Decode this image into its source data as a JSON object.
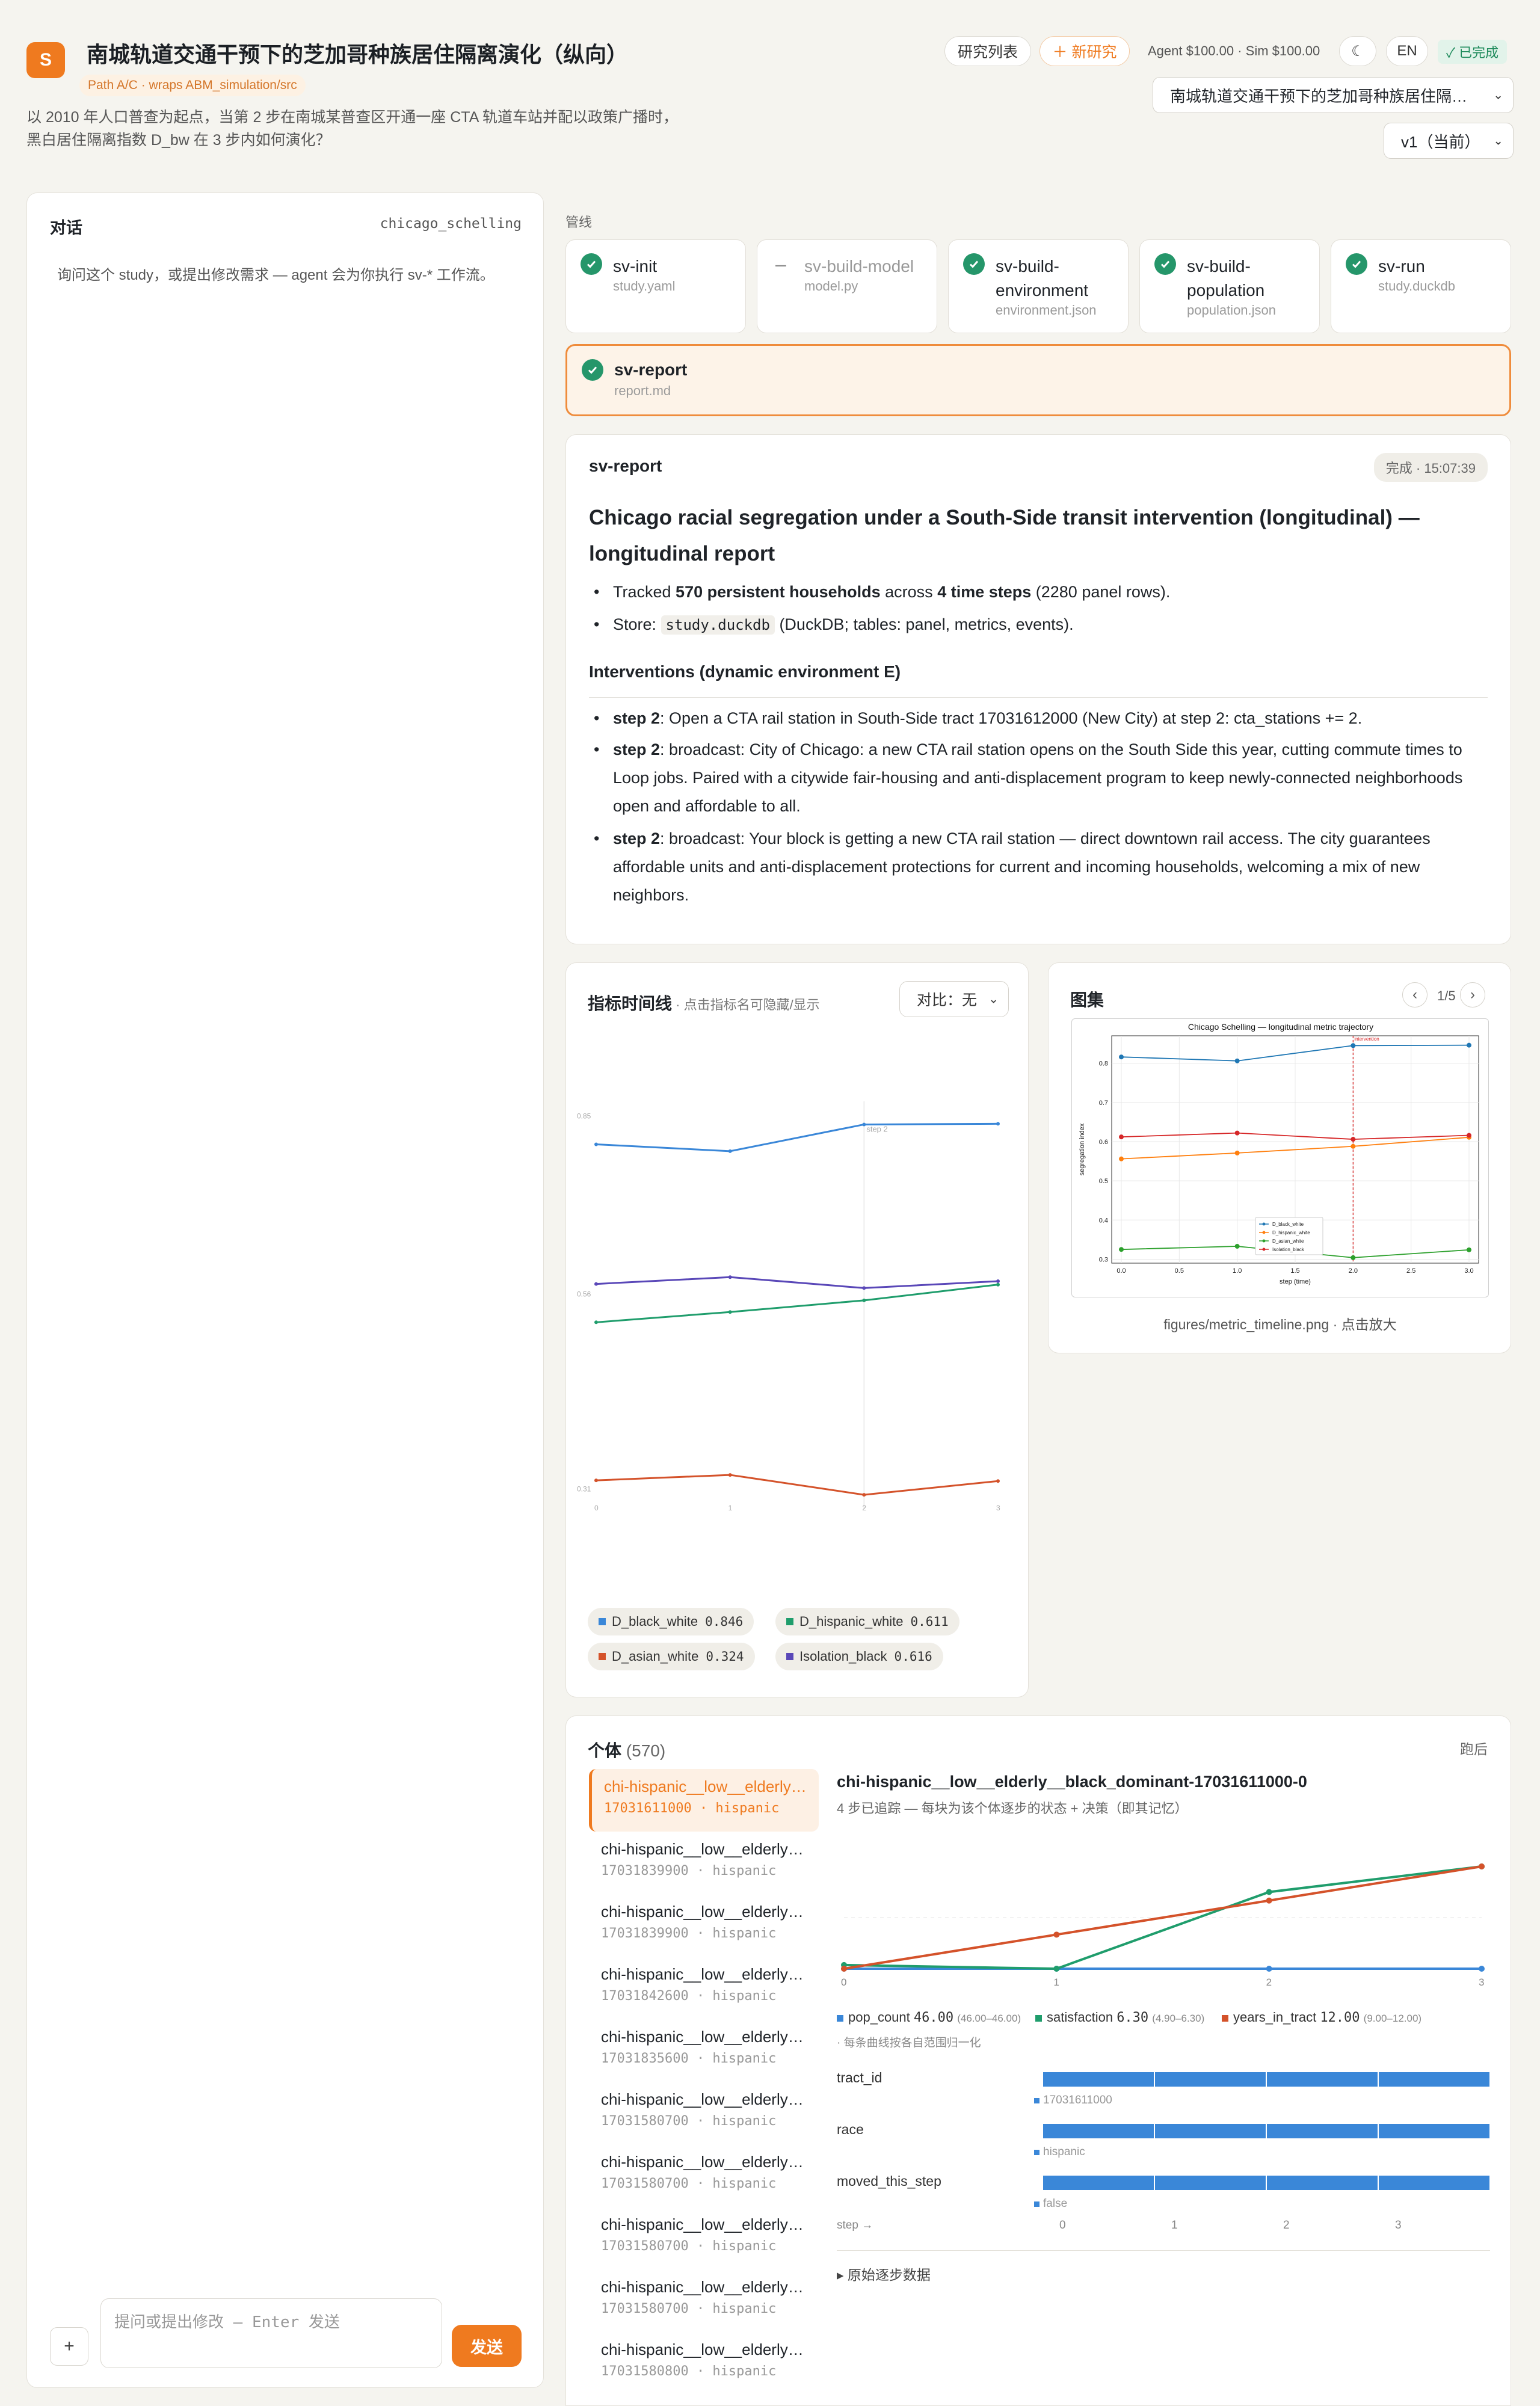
{
  "header": {
    "logo_letter": "S",
    "title": "南城轨道交通干预下的芝加哥种族居住隔离演化（纵向）",
    "path_badge": "Path A/C · wraps ABM_simulation/src",
    "description": "以 2010 年人口普查为起点，当第 2 步在南城某普查区开通一座 CTA 轨道车站并配以政策广播时，黑白居住隔离指数 D_bw 在 3 步内如何演化？",
    "btn_list": "研究列表",
    "btn_new": "＋ 新研究",
    "budget": "Agent $100.00 · Sim $100.00",
    "theme_icon": "☾",
    "lang": "EN",
    "status": "✓ 已完成",
    "study_select": "南城轨道交通干预下的芝加哥种族居住隔…",
    "version_select": "v1（当前）"
  },
  "chat": {
    "title": "对话",
    "study_id": "chicago_schelling",
    "hint": "询问这个 study，或提出修改需求 — agent 会为你执行 sv-* 工作流。",
    "input_placeholder": "提问或提出修改 — Enter 发送",
    "plus": "+",
    "send": "发送"
  },
  "pipeline": {
    "label": "管线",
    "stages": [
      {
        "name": "sv-init",
        "file": "study.yaml",
        "status": "done"
      },
      {
        "name": "sv-build-model",
        "file": "model.py",
        "status": "skipped"
      },
      {
        "name": "sv-build-environment",
        "file": "environment.json",
        "status": "done"
      },
      {
        "name": "sv-build-population",
        "file": "population.json",
        "status": "done"
      },
      {
        "name": "sv-run",
        "file": "study.duckdb",
        "status": "done"
      },
      {
        "name": "sv-report",
        "file": "report.md",
        "status": "done"
      }
    ]
  },
  "report": {
    "stage": "sv-report",
    "badge": "完成 · 15:07:39",
    "title": "Chicago racial segregation under a South-Side transit intervention (longitudinal) — longitudinal report",
    "b1_pre": "Tracked ",
    "b1_bold": "570 persistent households",
    "b1_mid": " across ",
    "b1_bold2": "4 time steps",
    "b1_post": " (2280 panel rows).",
    "b2_pre": "Store: ",
    "b2_code": "study.duckdb",
    "b2_post": " (DuckDB; tables: panel, metrics, events).",
    "interventions_title": "Interventions (dynamic environment E)",
    "i1_step": "step 2",
    "i1_text": ": Open a CTA rail station in South-Side tract 17031612000 (New City) at step 2: cta_stations += 2.",
    "i2_step": "step 2",
    "i2_text": ": broadcast: City of Chicago: a new CTA rail station opens on the South Side this year, cutting commute times to Loop jobs. Paired with a citywide fair-housing and anti-displacement program to keep newly-connected neighborhoods open and affordable to all.",
    "i3_step": "step 2",
    "i3_text": ": broadcast: Your block is getting a new CTA rail station — direct downtown rail access. The city guarantees affordable units and anti-displacement protections for current and incoming households, welcoming a mix of new neighbors."
  },
  "metrics": {
    "title": "指标时间线",
    "subtitle": " · 点击指标名可隐藏/显示",
    "compare": "对比：无",
    "step_marker": "step 2",
    "y_ticks": [
      "0.85",
      "0.56",
      "0.31"
    ],
    "x_ticks": [
      "0",
      "1",
      "2",
      "3"
    ],
    "legend": [
      {
        "name": "D_black_white",
        "value": "0.846",
        "color": "#3a87d8"
      },
      {
        "name": "D_hispanic_white",
        "value": "0.611",
        "color": "#1f9d6c"
      },
      {
        "name": "D_asian_white",
        "value": "0.324",
        "color": "#d4522a"
      },
      {
        "name": "Isolation_black",
        "value": "0.616",
        "color": "#5a48b8"
      }
    ]
  },
  "chart_data": [
    {
      "type": "line",
      "x": [
        0,
        1,
        2,
        3
      ],
      "series": [
        {
          "name": "D_black_white",
          "values": [
            0.816,
            0.806,
            0.845,
            0.846
          ]
        },
        {
          "name": "D_hispanic_white",
          "values": [
            0.556,
            0.571,
            0.588,
            0.611
          ]
        },
        {
          "name": "D_asian_white",
          "values": [
            0.325,
            0.333,
            0.304,
            0.324
          ]
        },
        {
          "name": "Isolation_black",
          "values": [
            0.612,
            0.622,
            0.606,
            0.616
          ]
        }
      ],
      "ylim": [
        0.29,
        0.87
      ],
      "annotations": [
        "step 2"
      ]
    },
    {
      "type": "line",
      "title": "Chicago Schelling — longitudinal metric trajectory",
      "xlabel": "step (time)",
      "ylabel": "segregation index",
      "x": [
        0,
        1,
        2,
        3
      ],
      "x_ticks": [
        "0.0",
        "0.5",
        "1.0",
        "1.5",
        "2.0",
        "2.5",
        "3.0"
      ],
      "y_ticks": [
        "0.3",
        "0.4",
        "0.5",
        "0.6",
        "0.7",
        "0.8"
      ],
      "series": [
        {
          "name": "D_black_white",
          "values": [
            0.816,
            0.806,
            0.845,
            0.846
          ]
        },
        {
          "name": "D_hispanic_white",
          "values": [
            0.556,
            0.571,
            0.588,
            0.611
          ]
        },
        {
          "name": "D_asian_white",
          "values": [
            0.325,
            0.333,
            0.304,
            0.324
          ]
        },
        {
          "name": "Isolation_black",
          "values": [
            0.612,
            0.622,
            0.606,
            0.616
          ]
        }
      ],
      "ylim": [
        0.29,
        0.87
      ],
      "annotations": [
        "intervention"
      ]
    },
    {
      "type": "line",
      "x": [
        0,
        1,
        2,
        3
      ],
      "series": [
        {
          "name": "pop_count",
          "values": [
            46,
            46,
            46,
            46
          ]
        },
        {
          "name": "satisfaction",
          "values": [
            4.95,
            4.9,
            5.95,
            6.3
          ]
        },
        {
          "name": "years_in_tract",
          "values": [
            9,
            10,
            11,
            12
          ]
        }
      ]
    }
  ],
  "gallery": {
    "title": "图集",
    "page": "1/5",
    "prev": "‹",
    "next": "›",
    "fig_title": "Chicago Schelling — longitudinal metric trajectory",
    "fig_xlabel": "step (time)",
    "fig_ylabel": "segregation index",
    "fig_annot": "intervention",
    "caption": "figures/metric_timeline.png · 点击放大"
  },
  "individuals": {
    "title": "个体",
    "count": "(570)",
    "ran": "跑后",
    "list": [
      {
        "name": "chi-hispanic__low__elderly__black_dominant",
        "meta": "17031611000 · hispanic"
      },
      {
        "name": "chi-hispanic__low__elderly__black_dominant",
        "meta": "17031839900 · hispanic"
      },
      {
        "name": "chi-hispanic__low__elderly__black_dominant",
        "meta": "17031839900 · hispanic"
      },
      {
        "name": "chi-hispanic__low__elderly__black_dominant",
        "meta": "17031842600 · hispanic"
      },
      {
        "name": "chi-hispanic__low__elderly__black_dominant",
        "meta": "17031835600 · hispanic"
      },
      {
        "name": "chi-hispanic__low__elderly__black_dominant",
        "meta": "17031580700 · hispanic"
      },
      {
        "name": "chi-hispanic__low__elderly__black_dominant",
        "meta": "17031580700 · hispanic"
      },
      {
        "name": "chi-hispanic__low__elderly__black_dominant",
        "meta": "17031580700 · hispanic"
      },
      {
        "name": "chi-hispanic__low__elderly__black_dominant",
        "meta": "17031580700 · hispanic"
      },
      {
        "name": "chi-hispanic__low__elderly__black_dominant",
        "meta": "17031580800 · hispanic"
      }
    ],
    "detail_title": "chi-hispanic__low__elderly__black_dominant-17031611000-0",
    "detail_sub": "4 步已追踪 — 每块为该个体逐步的状态 + 决策（即其记忆）",
    "x_ticks": [
      "0",
      "1",
      "2",
      "3"
    ],
    "legend": [
      {
        "name": "pop_count",
        "value": "46.00",
        "range": "(46.00–46.00)",
        "color": "#3a87d8"
      },
      {
        "name": "satisfaction",
        "value": "6.30",
        "range": "(4.90–6.30)",
        "color": "#1f9d6c"
      },
      {
        "name": "years_in_tract",
        "value": "12.00",
        "range": "(9.00–12.00)",
        "color": "#d4522a"
      }
    ],
    "norm_note": "· 每条曲线按各自范围归一化",
    "cats": [
      {
        "label": "tract_id",
        "value": "17031611000"
      },
      {
        "label": "race",
        "value": "hispanic"
      },
      {
        "label": "moved_this_step",
        "value": "false"
      }
    ],
    "step_label": "step →",
    "raw_toggle": "▸ 原始逐步数据"
  }
}
